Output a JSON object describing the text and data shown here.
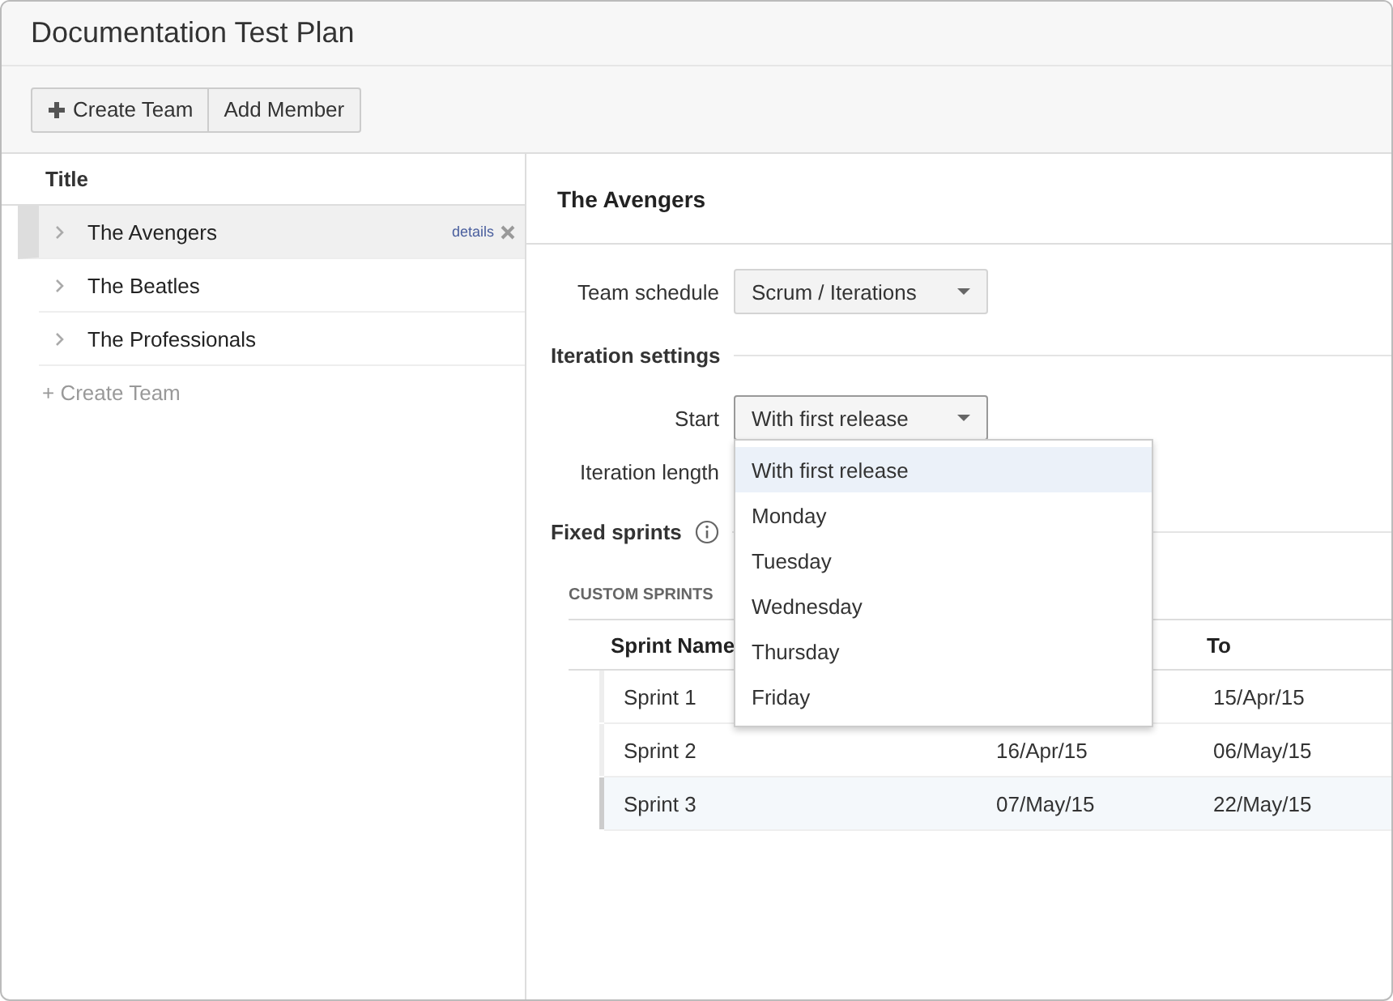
{
  "window": {
    "title": "Documentation Test Plan"
  },
  "toolbar": {
    "buttons": [
      {
        "label": "Create Team",
        "kind": "plus"
      },
      {
        "label": "Add Member",
        "kind": "plain"
      }
    ]
  },
  "sidebar": {
    "column": "Title",
    "items": [
      {
        "name": "The Avengers",
        "selected": true,
        "link": "details"
      },
      {
        "name": "The Beatles",
        "selected": false
      },
      {
        "name": "The Professionals",
        "selected": false
      }
    ],
    "create_link": "+ Create Team"
  },
  "detail": {
    "title": "The Avengers",
    "team_schedule": {
      "label": "Team schedule",
      "value": "Scrum / Iterations"
    },
    "iteration_section": "Iteration settings",
    "start": {
      "label": "Start",
      "value": "With first release",
      "expanded": true,
      "options": [
        {
          "label": "With first release",
          "selected": true
        },
        {
          "label": "Monday",
          "selected": false
        },
        {
          "label": "Tuesday",
          "selected": false
        },
        {
          "label": "Wednesday",
          "selected": false
        },
        {
          "label": "Thursday",
          "selected": false
        },
        {
          "label": "Friday",
          "selected": false
        }
      ]
    },
    "iteration_length": {
      "label": "Iteration length"
    },
    "fixed_section": "Fixed sprints",
    "custom_sprints": {
      "heading": "CUSTOM SPRINTS",
      "columns": {
        "column_1": "Sprint Name",
        "column_3": "To"
      },
      "rows": [
        {
          "name": "Sprint 1",
          "to": "15/Apr/15",
          "selected": false
        },
        {
          "name": "Sprint 2",
          "from": "16/Apr/15",
          "to": "06/May/15",
          "selected": false
        },
        {
          "name": "Sprint 3",
          "from": "07/May/15",
          "to": "22/May/15",
          "selected": true
        }
      ]
    }
  }
}
